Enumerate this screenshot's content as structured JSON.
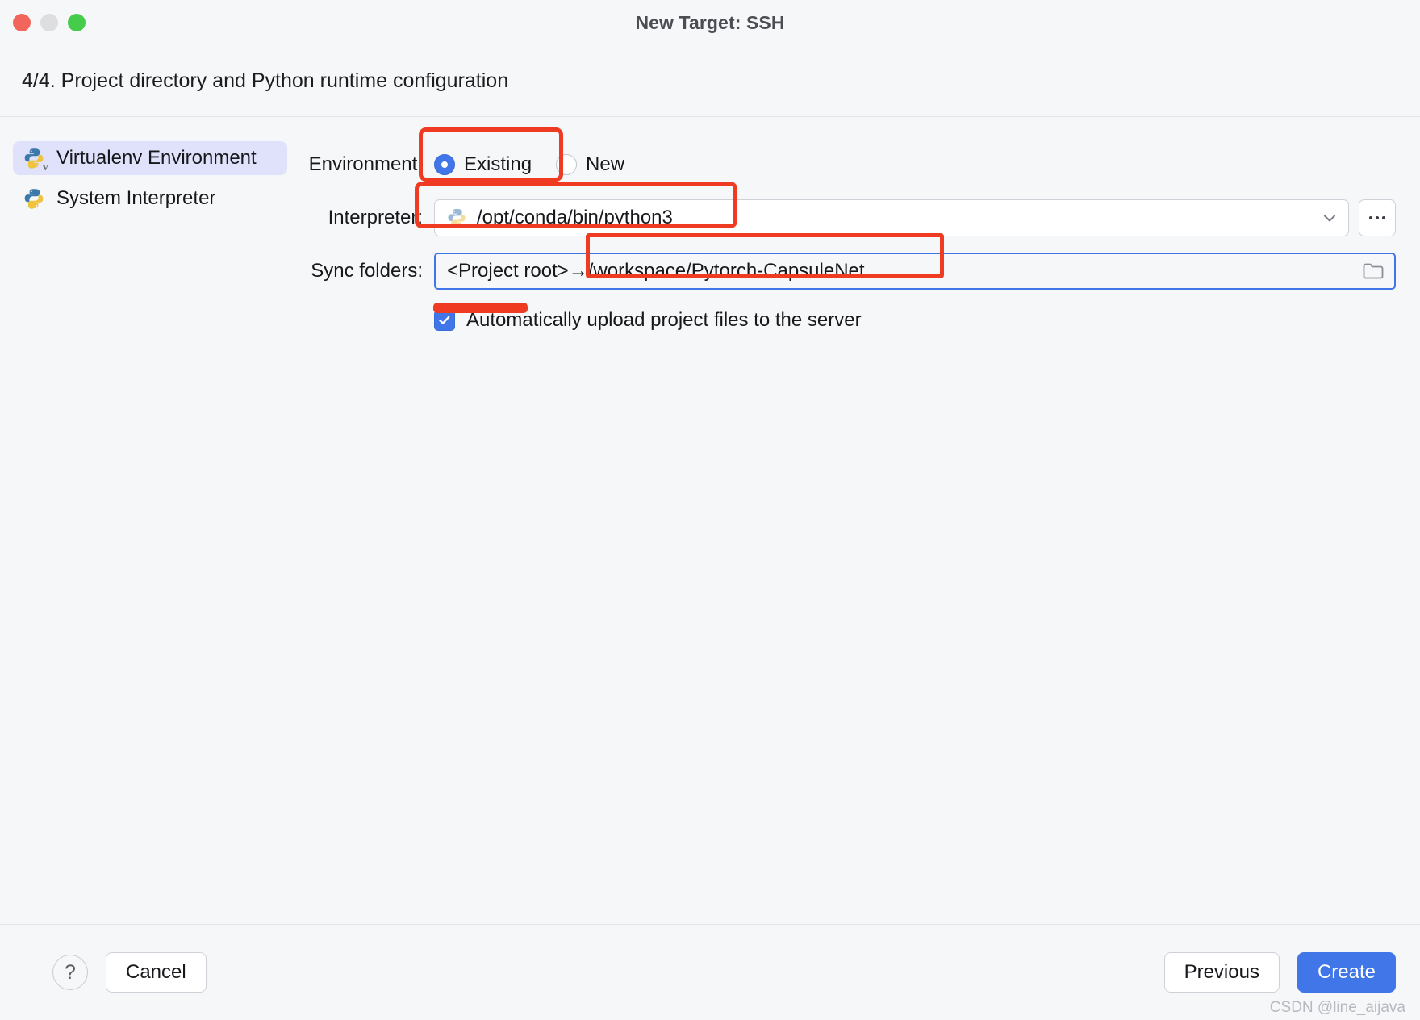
{
  "window": {
    "title": "New Target: SSH",
    "traffic_lights": [
      "close-button",
      "minimize-button",
      "maximize-button"
    ]
  },
  "step": {
    "title": "4/4. Project directory and Python runtime configuration"
  },
  "sidebar": {
    "items": [
      {
        "label": "Virtualenv Environment",
        "icon": "python-venv-icon",
        "selected": true
      },
      {
        "label": "System Interpreter",
        "icon": "python-icon",
        "selected": false
      }
    ]
  },
  "form": {
    "environment": {
      "label": "Environment:",
      "options": [
        {
          "label": "Existing",
          "selected": true
        },
        {
          "label": "New",
          "selected": false
        }
      ]
    },
    "interpreter": {
      "label": "Interpreter:",
      "value": "/opt/conda/bin/python3",
      "icon": "python-icon",
      "dropdown_icon": "chevron-down-icon",
      "browse_label": "...",
      "browse_icon": "ellipsis-icon"
    },
    "sync_folders": {
      "label": "Sync folders:",
      "value": "<Project root>→/workspace/Pytorch-CapsuleNet",
      "value_left": "<Project root>→",
      "value_right": "/workspace/Pytorch-CapsuleNet",
      "browse_icon": "folder-icon"
    },
    "auto_upload": {
      "label": "Automatically upload project files to the server",
      "checked": true
    }
  },
  "footer": {
    "help_label": "?",
    "cancel_label": "Cancel",
    "previous_label": "Previous",
    "create_label": "Create"
  },
  "annotations": {
    "highlight_color": "#ee3b22",
    "focus_color": "#4076e8",
    "targets": [
      "existing-radio-option",
      "interpreter-value",
      "sync-folders-remote-path",
      "auto-upload-checkbox"
    ]
  },
  "watermark": {
    "text": "CSDN @line_aijava"
  }
}
